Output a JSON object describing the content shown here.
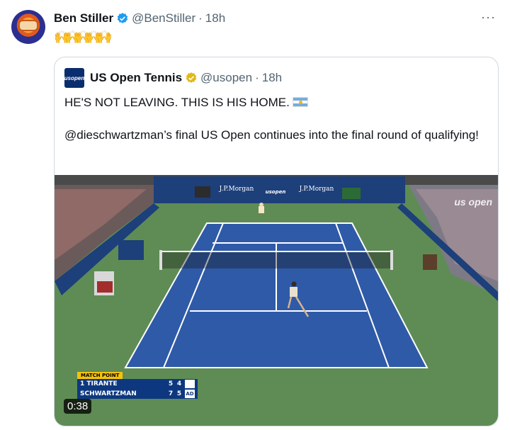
{
  "author": {
    "name": "Ben Stiller",
    "handle": "@BenStiller",
    "separator": "·",
    "time": "18h",
    "more_label": "···",
    "verified_icon": "verified-badge-icon",
    "avatar_icon": "avatar"
  },
  "tweet": {
    "emoji": [
      "🙌",
      "🙌",
      "🙌",
      "🙌",
      "🙌"
    ]
  },
  "quoted": {
    "logo_text": "usopen",
    "name": "US Open Tennis",
    "handle": "@usopen",
    "separator": "·",
    "time": "18h",
    "line1": "HE'S NOT LEAVING. THIS IS HIS HOME.",
    "line2": "@dieschwartzman’s final US Open continues into the final round of qualifying!",
    "flag_icon": "argentina-flag-icon"
  },
  "video": {
    "duration": "0:38",
    "watermark": "us open",
    "banner_left": "J.P.Morgan",
    "banner_center": "usopen",
    "banner_right": "J.P.Morgan",
    "scorebug": {
      "label": "MATCH POINT",
      "rows": [
        {
          "player": "1 TIRANTE",
          "s1": "5",
          "s2": "4",
          "box": ""
        },
        {
          "player": "SCHWARTZMAN",
          "s1": "7",
          "s2": "5",
          "box": "AD"
        }
      ]
    }
  },
  "colors": {
    "court_blue": "#2f5aa8",
    "surround_green": "#5f8c55",
    "verified_blue": "#1d9bf0",
    "verified_gold": "#e2b719"
  }
}
